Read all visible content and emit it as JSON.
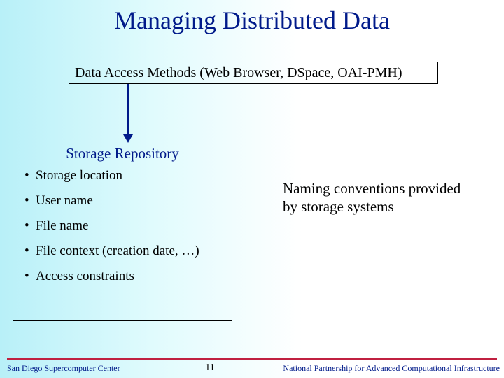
{
  "title": "Managing Distributed Data",
  "top_box": "Data Access Methods (Web Browser, DSpace, OAI-PMH)",
  "repo": {
    "title": "Storage Repository",
    "items": [
      "Storage location",
      "User name",
      "File name",
      "File context (creation date, …)",
      "Access constraints"
    ]
  },
  "side_note": "Naming conventions provided by storage systems",
  "footer": {
    "left": "San Diego Supercomputer Center",
    "page": "11",
    "right": "National Partnership for Advanced Computational Infrastructure"
  }
}
